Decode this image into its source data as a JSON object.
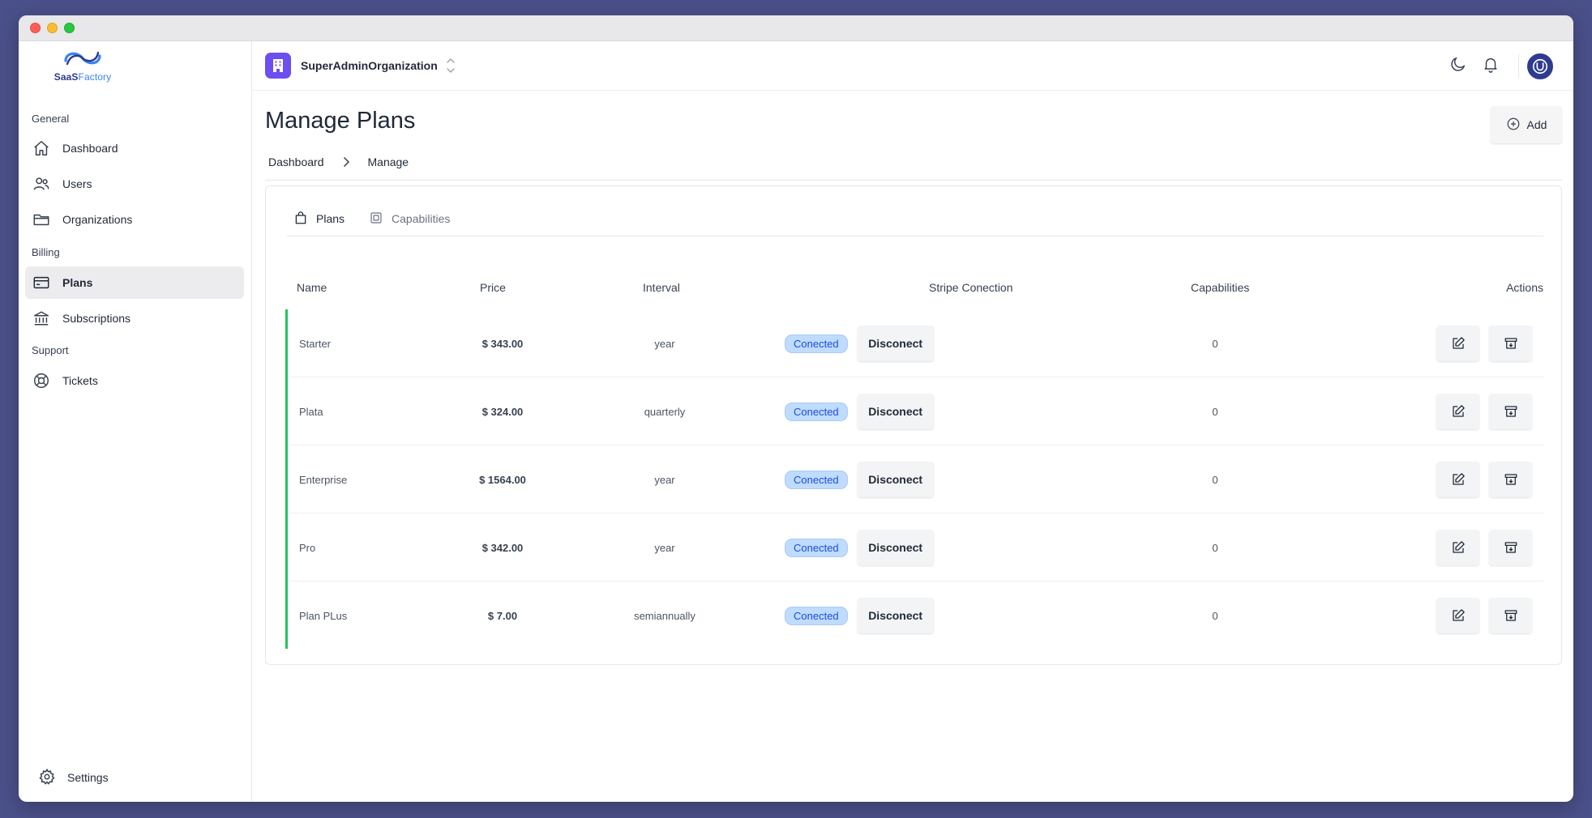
{
  "app": {
    "logo_text_a": "SaaS",
    "logo_text_b": "Factory"
  },
  "sidebar": {
    "sections": [
      {
        "label": "General"
      },
      {
        "label": "Billing"
      },
      {
        "label": "Support"
      }
    ],
    "items": [
      {
        "label": "Dashboard",
        "icon": "home-icon"
      },
      {
        "label": "Users",
        "icon": "users-icon"
      },
      {
        "label": "Organizations",
        "icon": "folder-icon"
      },
      {
        "label": "Plans",
        "icon": "credit-card-icon",
        "active": true
      },
      {
        "label": "Subscriptions",
        "icon": "bank-icon"
      },
      {
        "label": "Tickets",
        "icon": "lifebuoy-icon"
      }
    ],
    "settings_label": "Settings"
  },
  "topbar": {
    "org_name": "SuperAdminOrganization"
  },
  "page": {
    "title": "Manage Plans",
    "add_label": "Add",
    "breadcrumb": [
      "Dashboard",
      "Manage"
    ]
  },
  "tabs": [
    {
      "label": "Plans",
      "active": true
    },
    {
      "label": "Capabilities",
      "active": false
    }
  ],
  "table": {
    "headers": [
      "Name",
      "Price",
      "Interval",
      "Stripe Conection",
      "Capabilities",
      "Actions"
    ],
    "rows": [
      {
        "name": "Starter",
        "price": "$ 343.00",
        "interval": "year",
        "status": "Conected",
        "action": "Disconect",
        "capabilities": "0"
      },
      {
        "name": "Plata",
        "price": "$ 324.00",
        "interval": "quarterly",
        "status": "Conected",
        "action": "Disconect",
        "capabilities": "0"
      },
      {
        "name": "Enterprise",
        "price": "$ 1564.00",
        "interval": "year",
        "status": "Conected",
        "action": "Disconect",
        "capabilities": "0"
      },
      {
        "name": "Pro",
        "price": "$ 342.00",
        "interval": "year",
        "status": "Conected",
        "action": "Disconect",
        "capabilities": "0"
      },
      {
        "name": "Plan PLus",
        "price": "$ 7.00",
        "interval": "semiannually",
        "status": "Conected",
        "action": "Disconect",
        "capabilities": "0"
      }
    ]
  },
  "colors": {
    "background": "#4a5089",
    "accent": "#6d4ef0",
    "row_marker": "#22c55e",
    "badge": "#bfdbfe"
  }
}
